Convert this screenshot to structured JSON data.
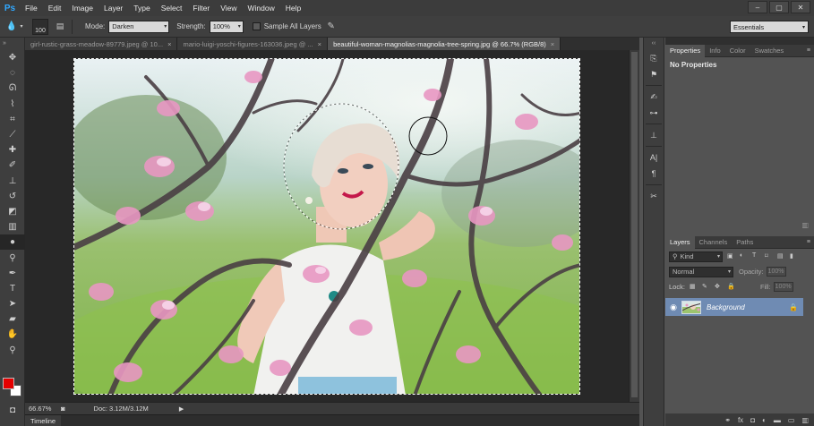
{
  "app": {
    "logo": "Ps"
  },
  "menu": [
    "File",
    "Edit",
    "Image",
    "Layer",
    "Type",
    "Select",
    "Filter",
    "View",
    "Window",
    "Help"
  ],
  "window_controls": [
    "–",
    "▢",
    "✕"
  ],
  "options": {
    "brush_size": "100",
    "mode_label": "Mode:",
    "mode_value": "Darken",
    "strength_label": "Strength:",
    "strength_value": "100%",
    "sample_all_layers": "Sample All Layers"
  },
  "workspace": "Essentials",
  "tabs": [
    {
      "label": "girl-rustic-grass-meadow-89779.jpeg @ 10...",
      "active": false
    },
    {
      "label": "mario-luigi-yoschi-figures-163036.jpeg @ ...",
      "active": false
    },
    {
      "label": "beautiful-woman-magnolias-magnolia-tree-spring.jpg @ 66.7% (RGB/8)",
      "active": true
    }
  ],
  "status": {
    "zoom": "66.67%",
    "doc": "Doc: 3.12M/3.12M"
  },
  "timeline_label": "Timeline",
  "properties_panel": {
    "tabs": [
      "Properties",
      "Info",
      "Color",
      "Swatches"
    ],
    "body": "No Properties"
  },
  "layers_panel": {
    "tabs": [
      "Layers",
      "Channels",
      "Paths"
    ],
    "kind_label": "Kind",
    "blend_mode": "Normal",
    "opacity_label": "Opacity:",
    "opacity_value": "100%",
    "lock_label": "Lock:",
    "fill_label": "Fill:",
    "fill_value": "100%",
    "layer_name": "Background"
  },
  "colors": {
    "foreground": "#e40000",
    "background": "#ffffff"
  }
}
